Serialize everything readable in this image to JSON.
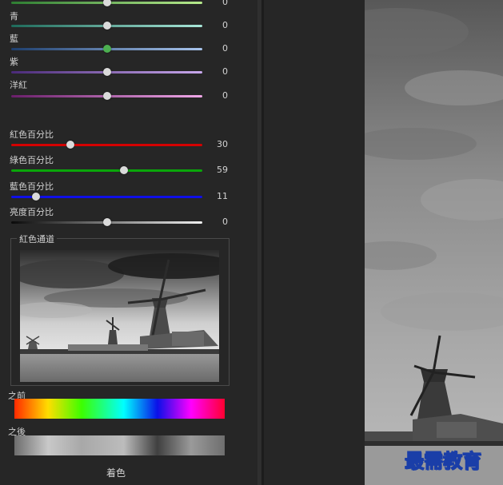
{
  "hue_sliders": [
    {
      "label": "",
      "value": "0",
      "gradient": [
        "#2e7d32",
        "#b7ea8c"
      ],
      "thumb_color": "#dadada",
      "position": 0.5
    },
    {
      "label": "青",
      "value": "0",
      "gradient": [
        "#1e6a5a",
        "#a8e6d8"
      ],
      "thumb_color": "#dadada",
      "position": 0.5
    },
    {
      "label": "藍",
      "value": "0",
      "gradient": [
        "#1e3f6e",
        "#a8c4ec"
      ],
      "thumb_color": "#4caf50",
      "position": 0.5
    },
    {
      "label": "紫",
      "value": "0",
      "gradient": [
        "#4a2a78",
        "#c8a8ec"
      ],
      "thumb_color": "#dadada",
      "position": 0.5
    },
    {
      "label": "洋紅",
      "value": "0",
      "gradient": [
        "#6a1e6a",
        "#f0a8e8"
      ],
      "thumb_color": "#dadada",
      "position": 0.5
    }
  ],
  "percent_sliders": [
    {
      "label": "紅色百分比",
      "value": "30",
      "color": "#d40000",
      "position": 0.31
    },
    {
      "label": "綠色百分比",
      "value": "59",
      "color": "#0aa60a",
      "position": 0.59
    },
    {
      "label": "藍色百分比",
      "value": "11",
      "color": "#1010e8",
      "position": 0.13
    },
    {
      "label": "亮度百分比",
      "value": "0",
      "gradient": [
        "#0a0a0a",
        "#f0f0f0"
      ],
      "position": 0.5
    }
  ],
  "channel_group": {
    "title": "紅色通道"
  },
  "before_label": "之前",
  "after_label": "之後",
  "tint_label": "着色",
  "watermark": "最需教育"
}
